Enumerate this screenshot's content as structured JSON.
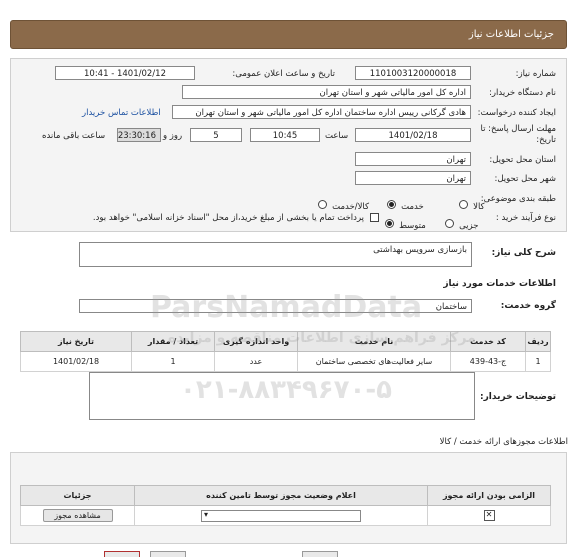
{
  "header": {
    "title": "جزئیات اطلاعات نیاز"
  },
  "form": {
    "need_number_label": "شماره نیاز:",
    "need_number": "1101003120000018",
    "announce_label": "تاریخ و ساعت اعلان عمومی:",
    "announce_value": "1401/02/12 - 10:41",
    "buyer_org_label": "نام دستگاه خریدار:",
    "buyer_org": "اداره کل امور مالیاتی شهر و استان تهران",
    "creator_label": "ایجاد کننده درخواست:",
    "creator": "هادی گرکانی رییس اداره ساختمان اداره کل امور مالیاتی شهر و استان تهران",
    "contact_link": "اطلاعات تماس خریدار",
    "deadline_label_1": "مهلت ارسال پاسخ: تا",
    "deadline_label_2": "تاریخ:",
    "deadline_date": "1401/02/18",
    "time_label": "ساعت",
    "deadline_time": "10:45",
    "days_value": "5",
    "days_label": "روز و",
    "remaining_time": "23:30:16",
    "remaining_label": "ساعت باقی مانده",
    "province_label": "استان محل تحویل:",
    "province": "تهران",
    "city_label": "شهر محل تحویل:",
    "city": "تهران",
    "category_label": "طبقه بندی موضوعی:",
    "category_options": [
      "کالا",
      "خدمت",
      "کالا/خدمت"
    ],
    "category_selected": 1,
    "process_label": "نوع فرآیند خرید :",
    "process_options": [
      "جزیی",
      "متوسط"
    ],
    "process_selected": 1,
    "treasury_note": "پرداخت تمام یا بخشی از مبلغ خرید،از محل \"اسناد خزانه اسلامی\" خواهد بود."
  },
  "summary": {
    "label": "شرح کلی نیاز:",
    "value": "بازسازی سرویس بهداشتی"
  },
  "services": {
    "section_title": "اطلاعات خدمات مورد نیاز",
    "group_label": "گروه خدمت:",
    "group_value": "ساختمان",
    "columns": [
      "ردیف",
      "کد خدمت",
      "نام خدمت",
      "واحد اندازه گیری",
      "تعداد / مقدار",
      "تاریخ نیاز"
    ],
    "rows": [
      {
        "row": "1",
        "code": "ج-43-439",
        "name": "سایر فعالیت‌های تخصصی ساختمان",
        "unit": "عدد",
        "qty": "1",
        "date": "1401/02/18"
      }
    ]
  },
  "buyer_notes": {
    "label": "توضیحات خریدار:",
    "value": ""
  },
  "licenses": {
    "section_title": "اطلاعات مجوزهای ارائه خدمت / کالا",
    "columns": [
      "الزامی بودن ارائه مجوز",
      "اعلام وضعیت مجوز توسط تامین کننده",
      "جزئیات"
    ],
    "view_button": "مشاهده مجوز"
  },
  "watermark": {
    "brand": "ParsNamadData",
    "tagline": "مرکز فراهم سازی اطلاعات مناقصه و مزایده",
    "phone": "۰۲۱-۸۸۳۴۹۶۷۰-۵"
  },
  "colors": {
    "header": "#8b6a4a",
    "link": "#1a4fa0"
  }
}
